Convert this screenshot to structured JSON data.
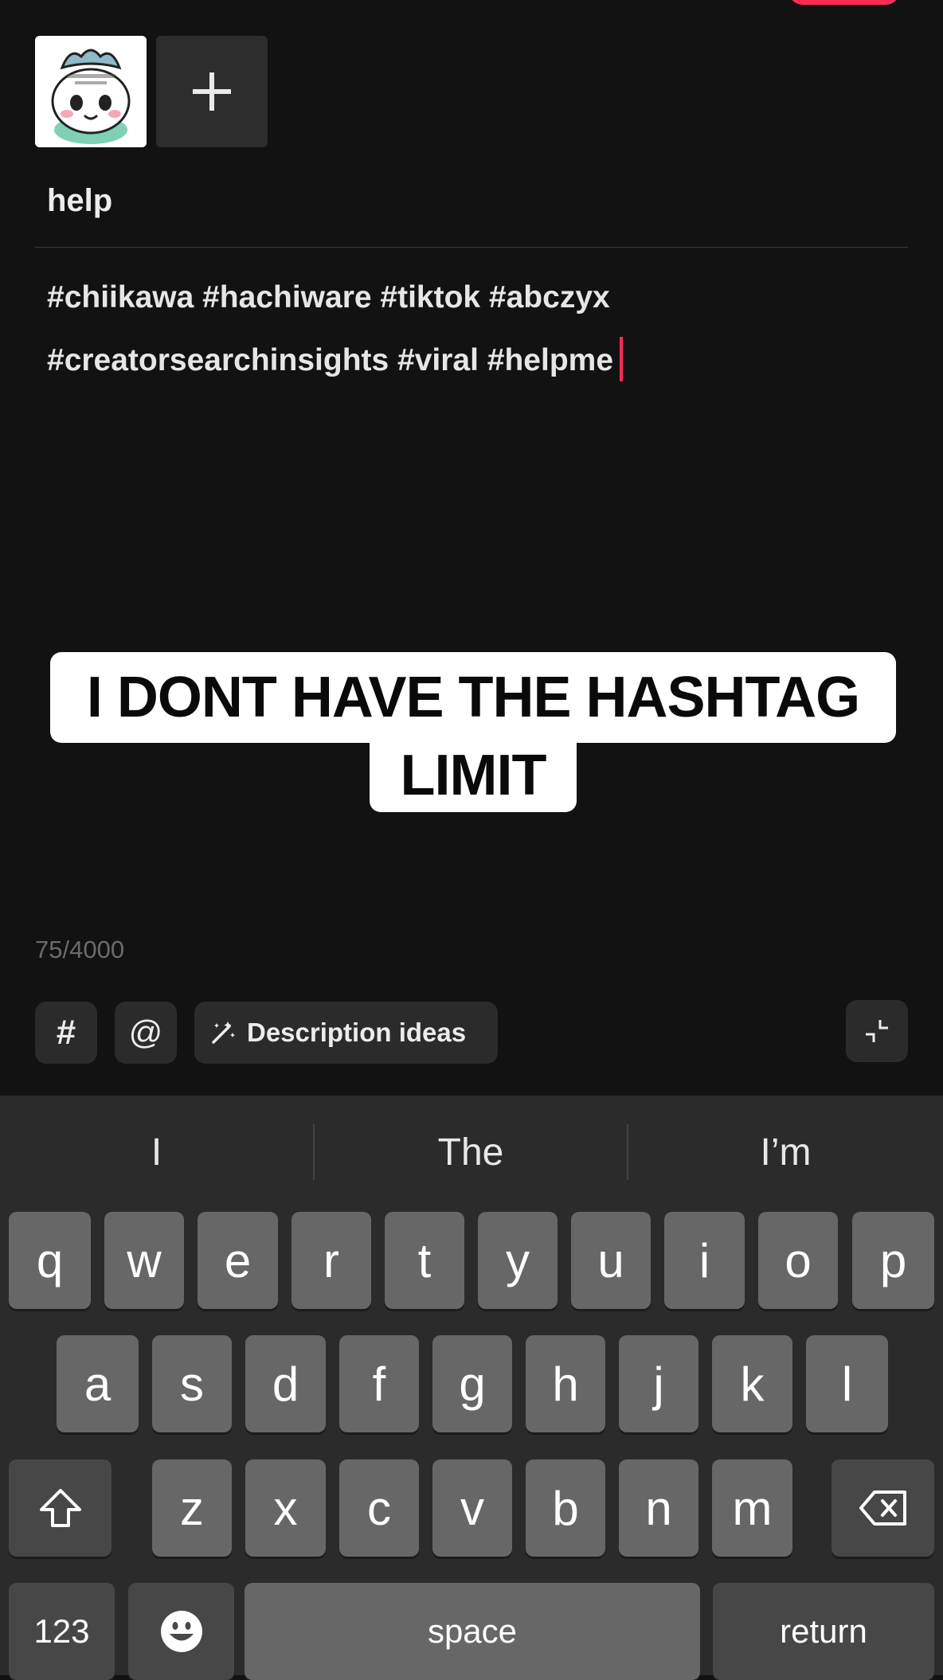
{
  "upload": {
    "add_icon": "plus-icon"
  },
  "post": {
    "title": "help",
    "description_lines": [
      "#chiikawa #hachiware #tiktok #abczyx",
      "#creatorsearchinsights #viral #helpme"
    ],
    "char_count": "75/4000"
  },
  "overlay": {
    "line1": "I DONT HAVE THE HASHTAG",
    "line2": "LIMIT"
  },
  "toolbar": {
    "hashtag_label": "#",
    "mention_label": "@",
    "ideas_label": "Description ideas",
    "ideas_icon": "magic-wand-icon",
    "collapse_icon": "collapse-icon"
  },
  "keyboard": {
    "suggestions": [
      "I",
      "The",
      "I’m"
    ],
    "row1": [
      "q",
      "w",
      "e",
      "r",
      "t",
      "y",
      "u",
      "i",
      "o",
      "p"
    ],
    "row2": [
      "a",
      "s",
      "d",
      "f",
      "g",
      "h",
      "j",
      "k",
      "l"
    ],
    "row3": [
      "z",
      "x",
      "c",
      "v",
      "b",
      "n",
      "m"
    ],
    "numbers_label": "123",
    "space_label": "space",
    "return_label": "return"
  },
  "colors": {
    "accent": "#fe2c55",
    "background": "#121212"
  }
}
